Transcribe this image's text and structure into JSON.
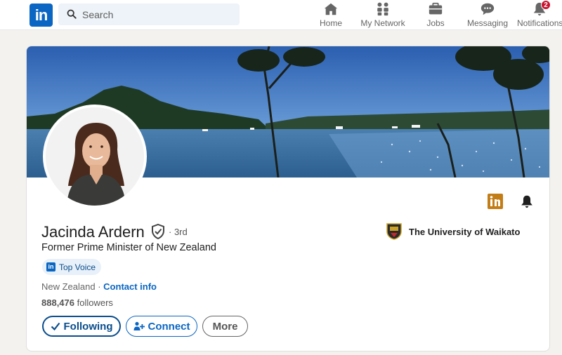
{
  "nav": {
    "logo_text": "in",
    "search_placeholder": "Search",
    "items": [
      {
        "label": "Home",
        "icon": "home-icon"
      },
      {
        "label": "My Network",
        "icon": "people-icon"
      },
      {
        "label": "Jobs",
        "icon": "briefcase-icon"
      },
      {
        "label": "Messaging",
        "icon": "chat-icon"
      },
      {
        "label": "Notifications",
        "icon": "bell-icon",
        "badge": "2"
      }
    ]
  },
  "profile": {
    "name": "Jacinda Ardern",
    "degree": "· 3rd",
    "headline": "Former Prime Minister of New Zealand",
    "badge_logo": "in",
    "badge": "Top Voice",
    "location": "New Zealand",
    "location_sep": " · ",
    "contact_link": "Contact info",
    "followers_count": "888,476",
    "followers_label": " followers",
    "buttons": {
      "following": "Following",
      "connect": "Connect",
      "more": "More"
    },
    "education": "The University of Waikato",
    "header_icons": [
      "linkedin-icon",
      "bell-icon"
    ]
  },
  "colors": {
    "brand": "#0a66c2",
    "badge_red": "#cb112d",
    "top_voice_bg": "#e8f0f9"
  }
}
